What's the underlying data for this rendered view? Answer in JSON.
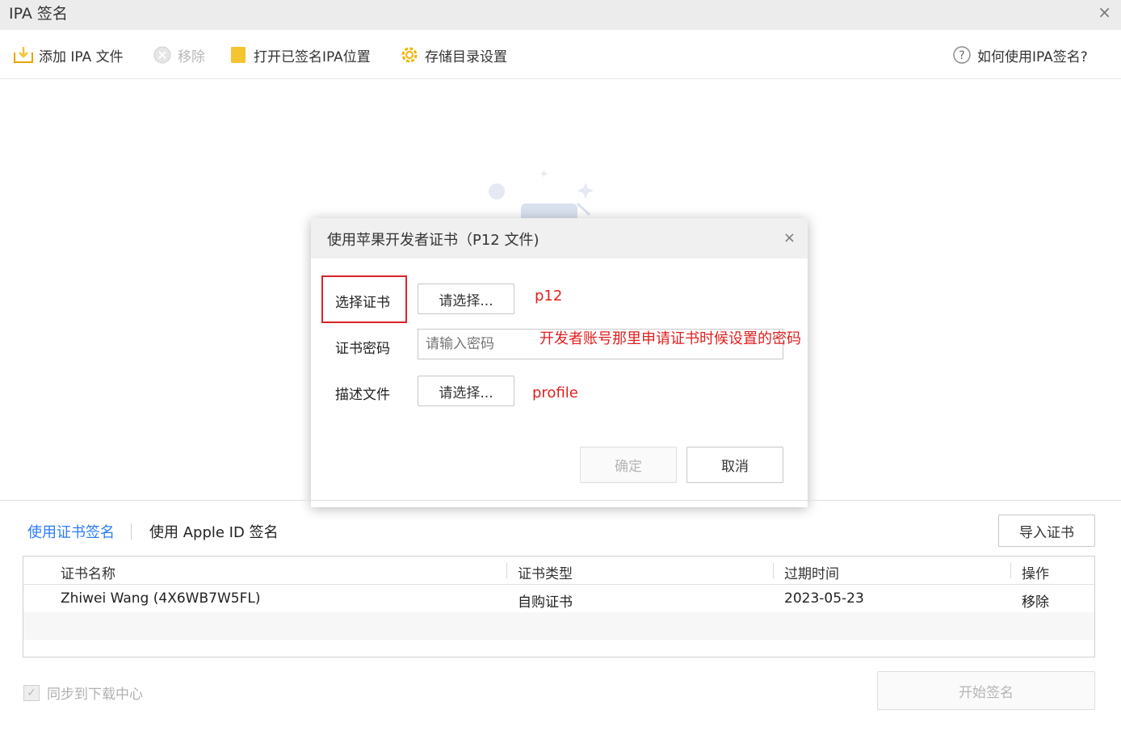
{
  "window": {
    "title": "IPA 签名",
    "close_glyph": "×"
  },
  "toolbar": {
    "add": {
      "label": "添加 IPA 文件",
      "icon": "add-file-icon"
    },
    "remove": {
      "label": "移除",
      "icon": "remove-icon"
    },
    "open_location": {
      "label": "打开已签名IPA位置",
      "icon": "folder-icon"
    },
    "storage_settings": {
      "label": "存储目录设置",
      "icon": "gear-icon"
    },
    "help": {
      "label": "如何使用IPA签名?",
      "icon": "help-icon"
    }
  },
  "dialog": {
    "title": "使用苹果开发者证书（P12 文件)",
    "close_glyph": "×",
    "select_cert_label": "选择证书",
    "select_cert_button": "请选择...",
    "password_label": "证书密码",
    "password_placeholder": "请输入密码",
    "profile_label": "描述文件",
    "profile_button": "请选择...",
    "ok_button": "确定",
    "cancel_button": "取消"
  },
  "annotations": {
    "p12_note": "p12",
    "password_note": "开发者账号那里申请证书时候设置的密码",
    "profile_note": "profile",
    "highlight_color": "#d8232a"
  },
  "bottom": {
    "tabs": [
      {
        "label": "使用证书签名",
        "active": true
      },
      {
        "label": "使用 Apple ID 签名",
        "active": false
      }
    ],
    "import_button": "导入证书",
    "table": {
      "columns": [
        "证书名称",
        "证书类型",
        "过期时间",
        "操作"
      ],
      "rows": [
        {
          "name": "Zhiwei Wang (4X6WB7W5FL)",
          "type": "自购证书",
          "expires": "2023-05-23",
          "action": "移除"
        }
      ]
    },
    "sync_label": "同步到下载中心",
    "sync_checked": true,
    "start_button": "开始签名"
  },
  "colors": {
    "accent": "#2b7cf6",
    "title_bar": "#ececec",
    "icon_yellow": "#f6c431"
  }
}
